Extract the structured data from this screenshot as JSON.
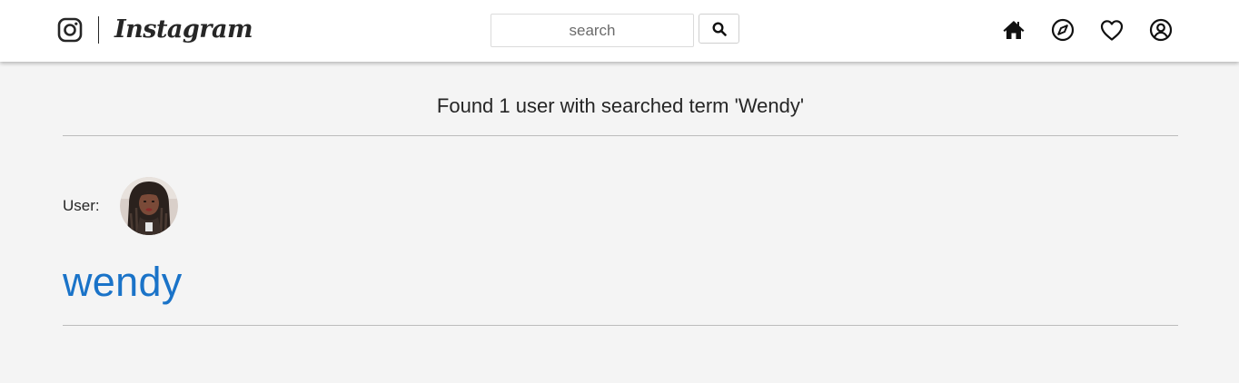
{
  "navbar": {
    "brand": {
      "wordmark": "Instagram",
      "logo_icon": "instagram-camera-icon"
    },
    "search": {
      "placeholder": "search",
      "value": "",
      "button_icon": "search-icon"
    },
    "icons": [
      "home-icon",
      "explore-compass-icon",
      "heart-icon",
      "profile-icon"
    ]
  },
  "results": {
    "heading": "Found 1 user with searched term 'Wendy'",
    "user_label": "User:",
    "users": [
      {
        "username": "wendy",
        "avatar": "avatar"
      }
    ]
  },
  "colors": {
    "link": "#1a73c8",
    "background": "#f4f4f4",
    "navbar": "#ffffff",
    "rule": "#bcbcbc"
  }
}
